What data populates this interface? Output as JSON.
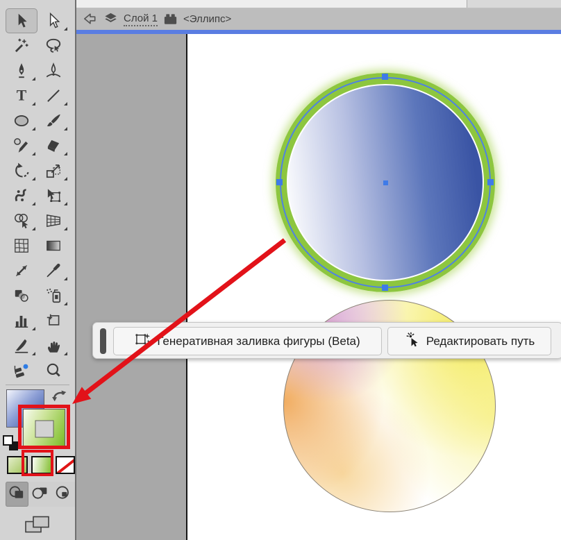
{
  "header": {
    "layer_name": "Слой 1",
    "object_name": "<Эллипс>"
  },
  "toolbar": {
    "tools": [
      {
        "name": "selection",
        "active": true,
        "flyout": false
      },
      {
        "name": "direct-selection",
        "active": false,
        "flyout": true
      },
      {
        "name": "magic-wand",
        "active": false,
        "flyout": false
      },
      {
        "name": "lasso",
        "active": false,
        "flyout": false
      },
      {
        "name": "pen",
        "active": false,
        "flyout": true
      },
      {
        "name": "curvature",
        "active": false,
        "flyout": false
      },
      {
        "name": "type",
        "active": false,
        "flyout": true
      },
      {
        "name": "line-segment",
        "active": false,
        "flyout": true
      },
      {
        "name": "ellipse",
        "active": false,
        "flyout": true
      },
      {
        "name": "paintbrush",
        "active": false,
        "flyout": true
      },
      {
        "name": "pencil",
        "active": false,
        "flyout": true
      },
      {
        "name": "eraser",
        "active": false,
        "flyout": true
      },
      {
        "name": "rotate",
        "active": false,
        "flyout": true
      },
      {
        "name": "scale",
        "active": false,
        "flyout": true
      },
      {
        "name": "puppet-warp",
        "active": false,
        "flyout": true
      },
      {
        "name": "free-transform",
        "active": false,
        "flyout": true
      },
      {
        "name": "shape-builder",
        "active": false,
        "flyout": true
      },
      {
        "name": "perspective-grid",
        "active": false,
        "flyout": true
      },
      {
        "name": "mesh",
        "active": false,
        "flyout": false
      },
      {
        "name": "gradient",
        "active": false,
        "flyout": false
      },
      {
        "name": "width",
        "active": false,
        "flyout": false
      },
      {
        "name": "eyedropper",
        "active": false,
        "flyout": true
      },
      {
        "name": "blend",
        "active": false,
        "flyout": false
      },
      {
        "name": "symbol-sprayer",
        "active": false,
        "flyout": true
      },
      {
        "name": "column-graph",
        "active": false,
        "flyout": true
      },
      {
        "name": "artboard",
        "active": false,
        "flyout": false
      },
      {
        "name": "slice",
        "active": false,
        "flyout": true
      },
      {
        "name": "hand",
        "active": false,
        "flyout": true
      },
      {
        "name": "rotate-view",
        "active": false,
        "flyout": false
      },
      {
        "name": "zoom",
        "active": false,
        "flyout": false
      }
    ],
    "fill_swatch": {
      "type": "gradient",
      "from": "#f1f3fb",
      "to": "#2e4da0"
    },
    "stroke_swatch": {
      "type": "gradient",
      "from": "#f6faee",
      "to": "#7cb52f",
      "selected": true
    },
    "paint_buttons": [
      {
        "name": "color",
        "highlighted": false
      },
      {
        "name": "gradient",
        "highlighted": true
      },
      {
        "name": "none",
        "highlighted": false
      }
    ],
    "drawing_modes": [
      {
        "name": "draw-normal",
        "active": true
      },
      {
        "name": "draw-behind",
        "active": false
      },
      {
        "name": "draw-inside",
        "active": false
      }
    ]
  },
  "taskbar": {
    "buttons": [
      {
        "label": "Генеративная заливка фигуры (Beta)",
        "icon": "generative-fill-icon"
      },
      {
        "label": "Редактировать путь",
        "icon": "edit-path-icon"
      }
    ]
  },
  "canvas": {
    "selected_ellipse": {
      "stroke_color": "#8dc63f",
      "fill_gradient": [
        "#ffffff",
        "#3b55a5"
      ],
      "selection_color": "#4a7fe0"
    },
    "freeform_ellipse": {
      "colors": [
        "#d8a0cd",
        "#f0aa5a",
        "#f4eb5a",
        "#ffffff"
      ],
      "stroke_color": "#8a8275"
    }
  },
  "annotations": {
    "arrow_color": "#e21219",
    "highlight_box_count": 2
  }
}
